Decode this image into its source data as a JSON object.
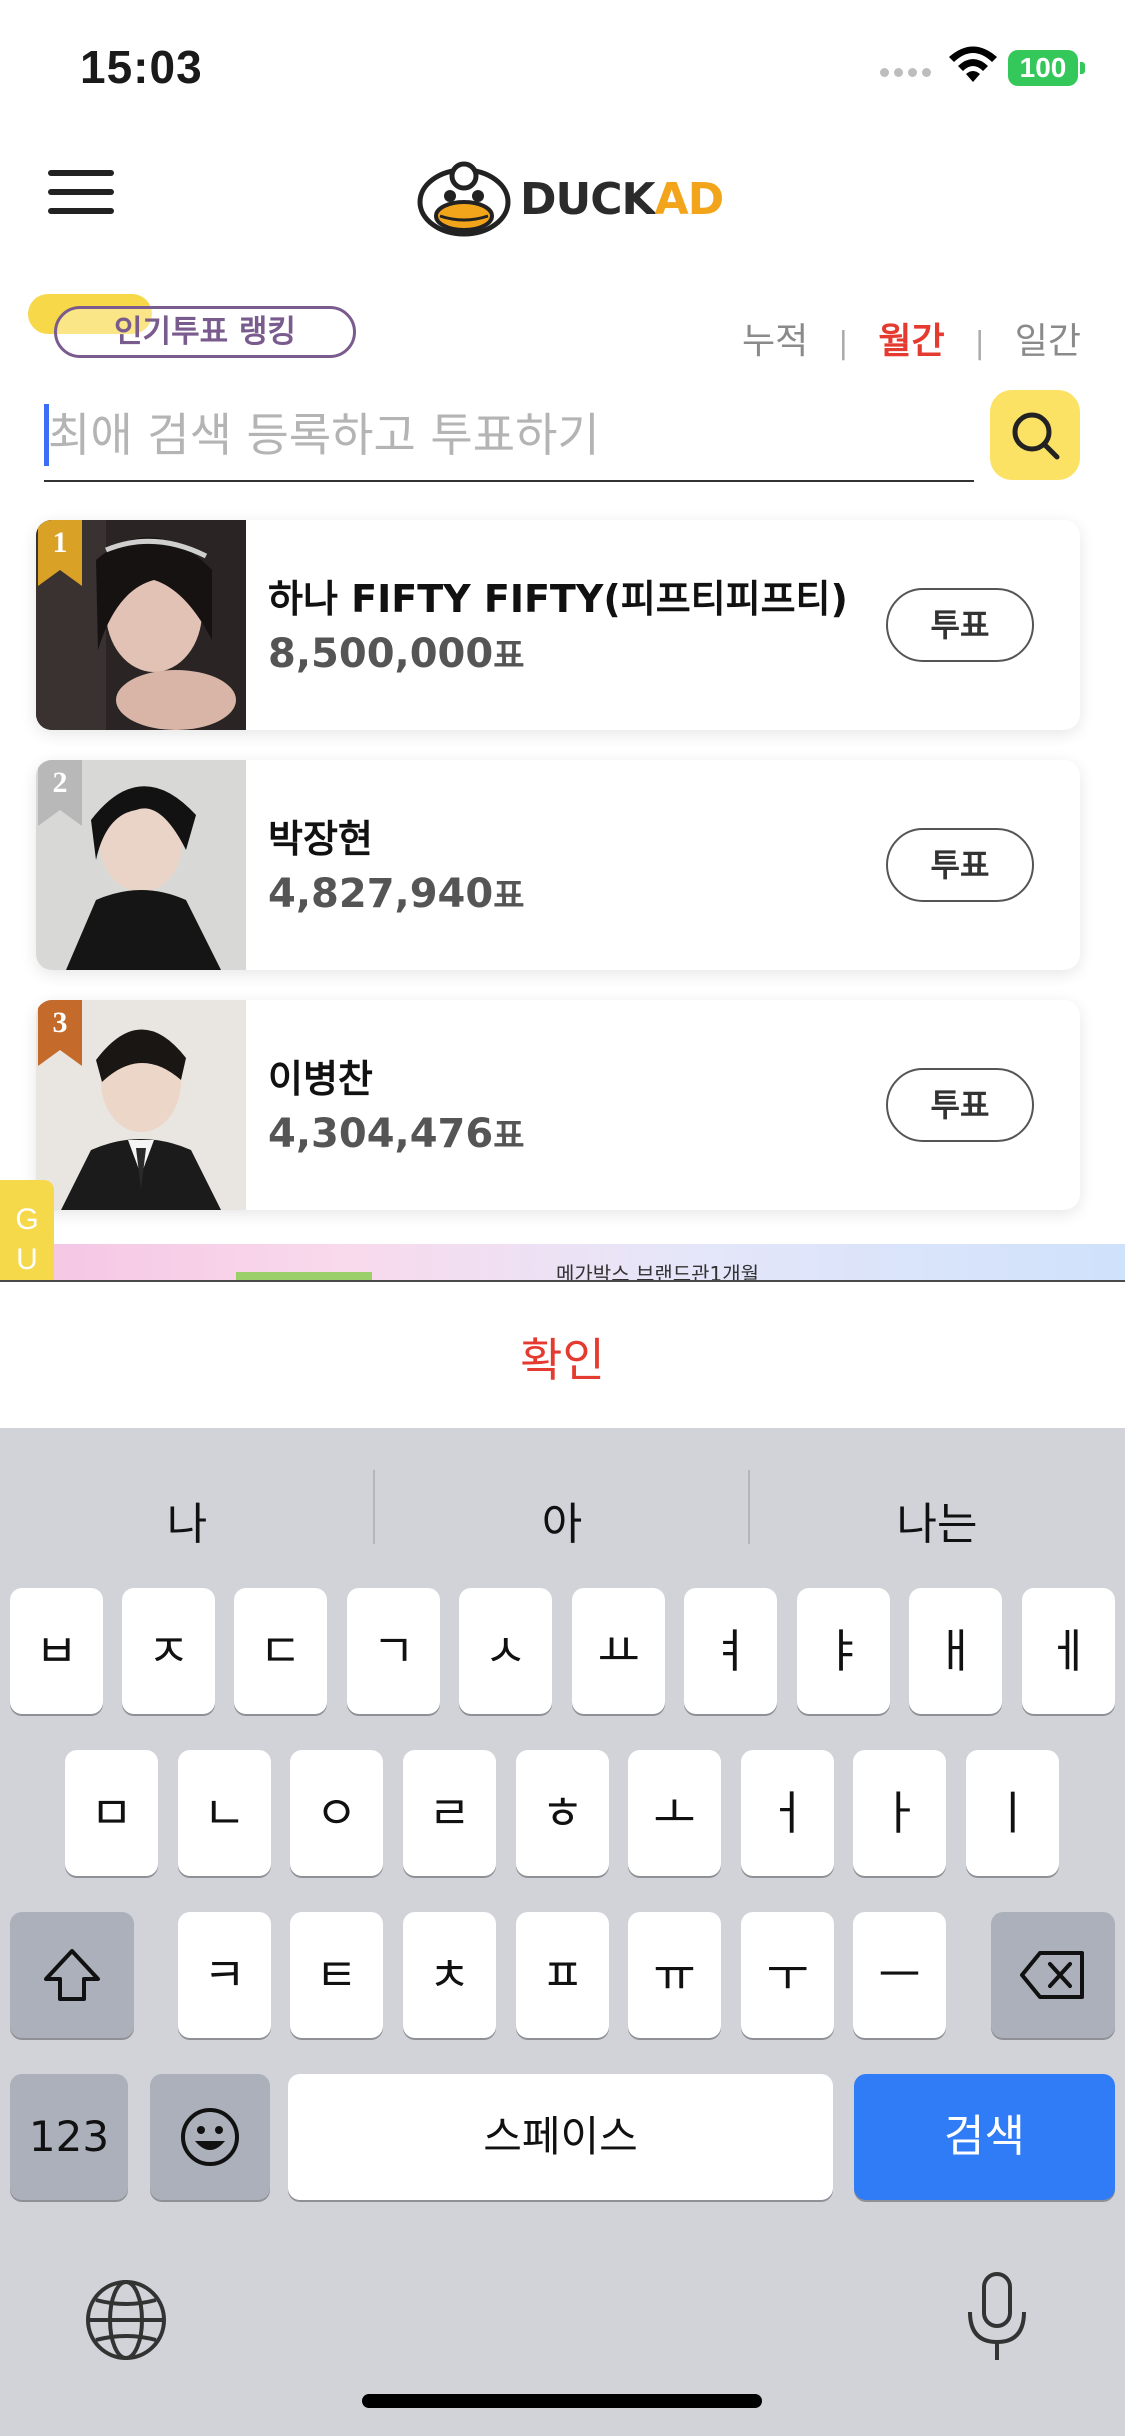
{
  "status_bar": {
    "time": "15:03",
    "battery": "100",
    "wifi_icon": "wifi-icon"
  },
  "header": {
    "logo_duck": "DUCK",
    "logo_ad": "AD",
    "menu_icon": "hamburger-menu-icon",
    "brand_colors": {
      "duck_text": "#2b2b2b",
      "ad_text": "#f2a51a"
    }
  },
  "ranking": {
    "title": "인기투표 랭킹",
    "tabs": [
      {
        "label": "누적",
        "active": false
      },
      {
        "label": "월간",
        "active": true
      },
      {
        "label": "일간",
        "active": false
      }
    ],
    "accent_color": "#e53a2f"
  },
  "search": {
    "placeholder": "최애 검색 등록하고 투표하기",
    "value": "",
    "button_icon": "search-icon",
    "button_color": "#fbe264"
  },
  "entries": [
    {
      "rank": "1",
      "name": "하나 FIFTY FIFTY(피프티피프티)",
      "votes": "8,500,000",
      "unit": "표",
      "vote_label": "투표",
      "badge_color": "#d9a227"
    },
    {
      "rank": "2",
      "name": "박장현",
      "votes": "4,827,940",
      "unit": "표",
      "vote_label": "투표",
      "badge_color": "#b8b8b8"
    },
    {
      "rank": "3",
      "name": "이병찬",
      "votes": "4,304,476",
      "unit": "표",
      "vote_label": "투표",
      "badge_color": "#c46a2b"
    }
  ],
  "side_tab": {
    "line1": "G",
    "line2": "U"
  },
  "banner": {
    "text": "메가박스 브랜드관1개월"
  },
  "confirm": {
    "label": "확인"
  },
  "keyboard": {
    "suggestions": [
      "나",
      "아",
      "나는"
    ],
    "row1": [
      "ㅂ",
      "ㅈ",
      "ㄷ",
      "ㄱ",
      "ㅅ",
      "ㅛ",
      "ㅕ",
      "ㅑ",
      "ㅐ",
      "ㅔ"
    ],
    "row2": [
      "ㅁ",
      "ㄴ",
      "ㅇ",
      "ㄹ",
      "ㅎ",
      "ㅗ",
      "ㅓ",
      "ㅏ",
      "ㅣ"
    ],
    "row3": [
      "ㅋ",
      "ㅌ",
      "ㅊ",
      "ㅍ",
      "ㅠ",
      "ㅜ",
      "ㅡ"
    ],
    "numbers": "123",
    "space": "스페이스",
    "search": "검색",
    "shift_icon": "shift-icon",
    "backspace_icon": "backspace-icon",
    "emoji_icon": "emoji-icon",
    "globe_icon": "globe-icon",
    "mic_icon": "microphone-icon"
  }
}
